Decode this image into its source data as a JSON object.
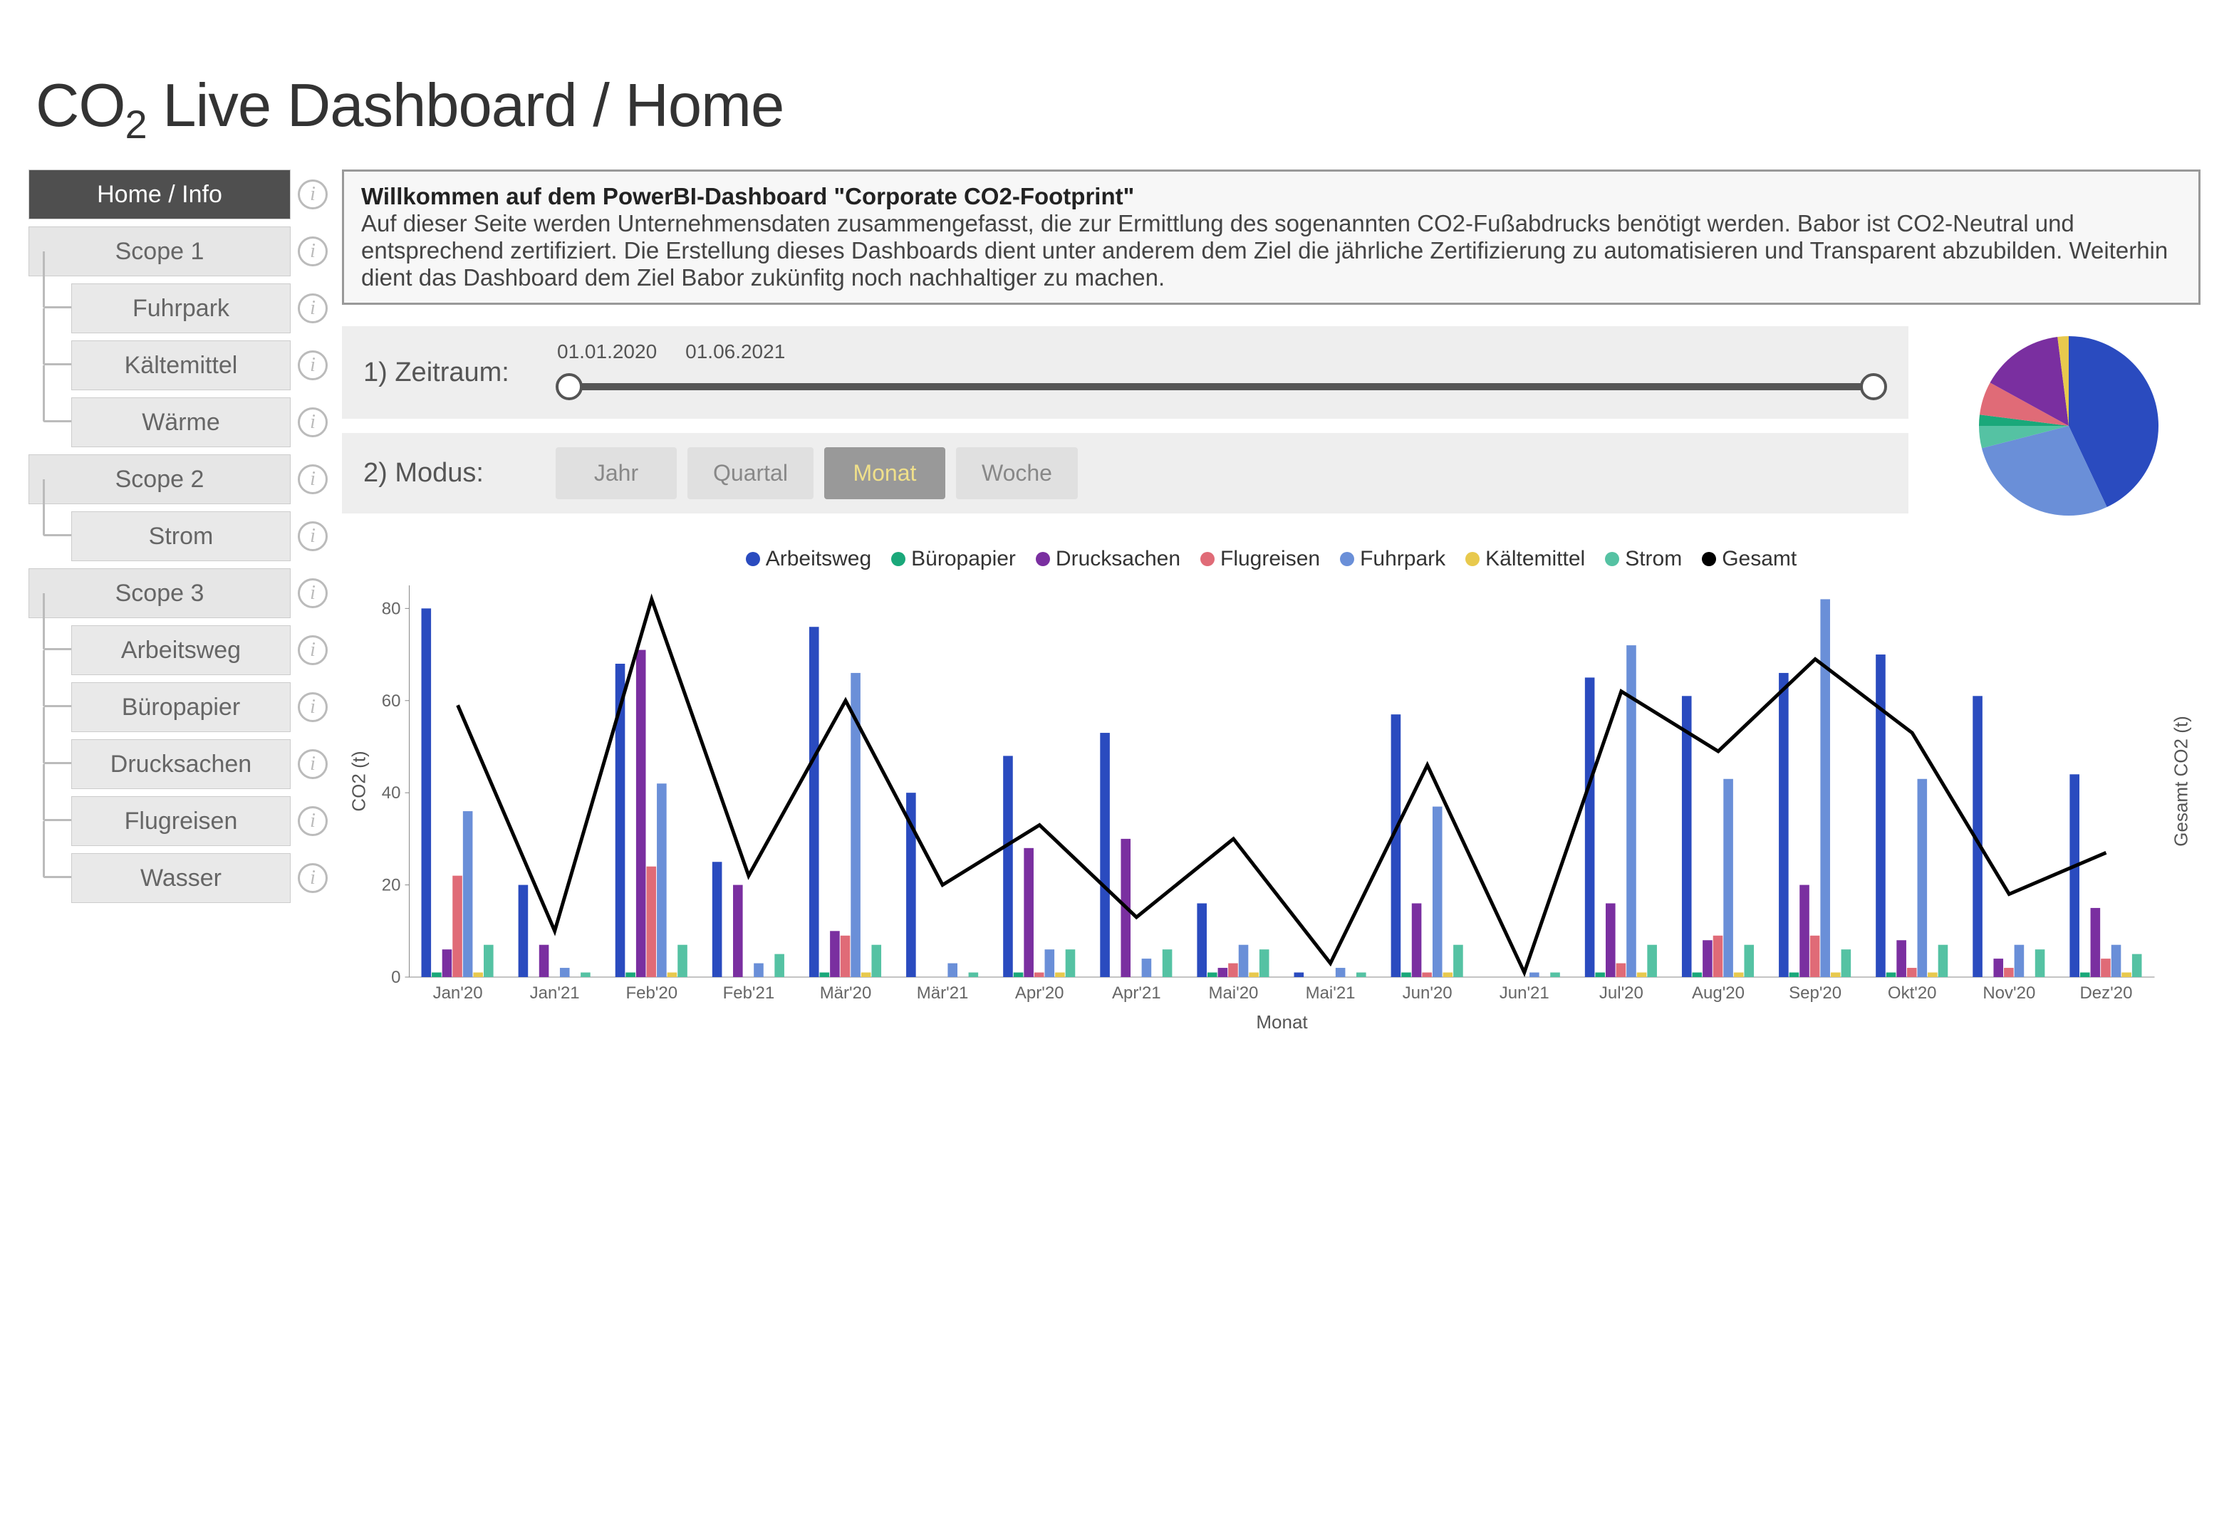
{
  "title_html": "CO<sub>2</sub> Live Dashboard / Home",
  "sidebar": [
    {
      "label": "Home / Info",
      "active": true,
      "child": false
    },
    {
      "label": "Scope 1",
      "active": false,
      "child": false
    },
    {
      "label": "Fuhrpark",
      "active": false,
      "child": true
    },
    {
      "label": "Kältemittel",
      "active": false,
      "child": true
    },
    {
      "label": "Wärme",
      "active": false,
      "child": true
    },
    {
      "label": "Scope 2",
      "active": false,
      "child": false
    },
    {
      "label": "Strom",
      "active": false,
      "child": true
    },
    {
      "label": "Scope 3",
      "active": false,
      "child": false
    },
    {
      "label": "Arbeitsweg",
      "active": false,
      "child": true
    },
    {
      "label": "Büropapier",
      "active": false,
      "child": true
    },
    {
      "label": "Drucksachen",
      "active": false,
      "child": true
    },
    {
      "label": "Flugreisen",
      "active": false,
      "child": true
    },
    {
      "label": "Wasser",
      "active": false,
      "child": true
    }
  ],
  "intro": {
    "headline": "Willkommen auf dem PowerBI-Dashboard \"Corporate CO2-Footprint\"",
    "body": "Auf dieser Seite werden Unternehmensdaten zusammengefasst, die zur Ermittlung des sogenannten CO2-Fußabdrucks benötigt werden. Babor ist CO2-Neutral und entsprechend zertifiziert. Die Erstellung dieses Dashboards dient unter anderem dem Ziel die jährliche Zertifizierung zu automatisieren und Transparent abzubilden. Weiterhin dient das Dashboard dem Ziel Babor zukünfitg noch nachhaltiger zu machen."
  },
  "controls": {
    "zeitraum_label": "1) Zeitraum:",
    "date_from": "01.01.2020",
    "date_to": "01.06.2021",
    "modus_label": "2) Modus:",
    "modes": [
      {
        "label": "Jahr",
        "selected": false
      },
      {
        "label": "Quartal",
        "selected": false
      },
      {
        "label": "Monat",
        "selected": true
      },
      {
        "label": "Woche",
        "selected": false
      }
    ]
  },
  "colors": {
    "Arbeitsweg": "#2a4bbf",
    "Büropapier": "#1aa87a",
    "Drucksachen": "#7a2fa0",
    "Flugreisen": "#e06b77",
    "Fuhrpark": "#6a8fd8",
    "Kältemittel": "#e8c94d",
    "Strom": "#55c2a3",
    "Gesamt": "#000000"
  },
  "chart_data": [
    {
      "type": "pie",
      "title": "",
      "series": [
        {
          "name": "Arbeitsweg",
          "value": 43,
          "color": "#2a4bbf"
        },
        {
          "name": "Fuhrpark",
          "value": 28,
          "color": "#6a8fd8"
        },
        {
          "name": "Strom",
          "value": 4,
          "color": "#55c2a3"
        },
        {
          "name": "Büropapier",
          "value": 2,
          "color": "#1aa87a"
        },
        {
          "name": "Flugreisen",
          "value": 6,
          "color": "#e06b77"
        },
        {
          "name": "Drucksachen",
          "value": 15,
          "color": "#7a2fa0"
        },
        {
          "name": "Kältemittel",
          "value": 2,
          "color": "#e8c94d"
        }
      ]
    },
    {
      "type": "bar",
      "title": "",
      "xlabel": "Monat",
      "ylabel": "CO2 (t)",
      "y2label": "Gesamt CO2 (t)",
      "ylim": [
        0,
        85
      ],
      "categories": [
        "Jan'20",
        "Jan'21",
        "Feb'20",
        "Feb'21",
        "Mär'20",
        "Mär'21",
        "Apr'20",
        "Apr'21",
        "Mai'20",
        "Mai'21",
        "Jun'20",
        "Jun'21",
        "Jul'20",
        "Aug'20",
        "Sep'20",
        "Okt'20",
        "Nov'20",
        "Dez'20"
      ],
      "series": [
        {
          "name": "Arbeitsweg",
          "color": "#2a4bbf",
          "values": [
            80,
            20,
            68,
            25,
            76,
            40,
            48,
            53,
            16,
            1,
            57,
            0,
            65,
            61,
            66,
            70,
            61,
            44
          ]
        },
        {
          "name": "Büropapier",
          "color": "#1aa87a",
          "values": [
            1,
            0,
            1,
            0,
            1,
            0,
            1,
            0,
            1,
            0,
            1,
            0,
            1,
            1,
            1,
            1,
            0,
            1
          ]
        },
        {
          "name": "Drucksachen",
          "color": "#7a2fa0",
          "values": [
            6,
            7,
            71,
            20,
            10,
            0,
            28,
            30,
            2,
            0,
            16,
            0,
            16,
            8,
            20,
            8,
            4,
            15
          ]
        },
        {
          "name": "Flugreisen",
          "color": "#e06b77",
          "values": [
            22,
            0,
            24,
            0,
            9,
            0,
            1,
            0,
            3,
            0,
            1,
            0,
            3,
            9,
            9,
            2,
            2,
            4
          ]
        },
        {
          "name": "Fuhrpark",
          "color": "#6a8fd8",
          "values": [
            36,
            2,
            42,
            3,
            66,
            3,
            6,
            4,
            7,
            2,
            37,
            1,
            72,
            43,
            82,
            43,
            7,
            7
          ]
        },
        {
          "name": "Kältemittel",
          "color": "#e8c94d",
          "values": [
            1,
            0,
            1,
            0,
            1,
            0,
            1,
            0,
            1,
            0,
            1,
            0,
            1,
            1,
            1,
            1,
            0,
            1
          ]
        },
        {
          "name": "Strom",
          "color": "#55c2a3",
          "values": [
            7,
            1,
            7,
            5,
            7,
            1,
            6,
            6,
            6,
            1,
            7,
            1,
            7,
            7,
            6,
            7,
            6,
            5
          ]
        }
      ],
      "line": {
        "name": "Gesamt",
        "color": "#000000",
        "values": [
          59,
          10,
          82,
          22,
          60,
          20,
          33,
          13,
          30,
          3,
          46,
          1,
          62,
          49,
          69,
          53,
          18,
          27
        ]
      }
    }
  ]
}
